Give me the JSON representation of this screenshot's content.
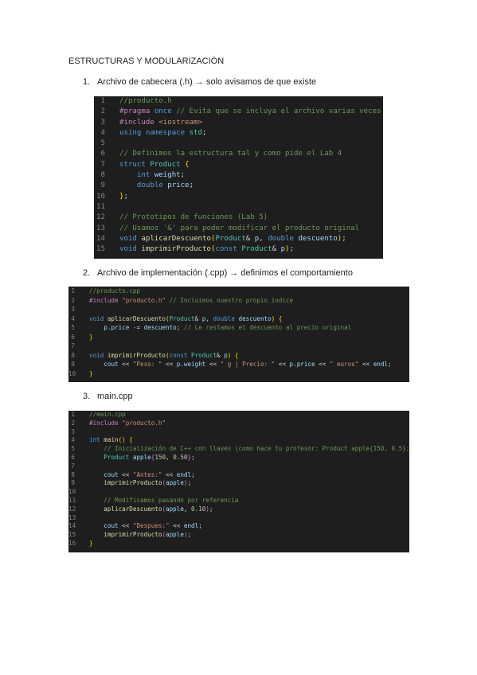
{
  "heading": "ESTRUCTURAS Y MODULARIZACIÓN",
  "items": [
    {
      "number": "1.",
      "label": "Archivo de cabecera (.h) → solo avisamos de que existe"
    },
    {
      "number": "2.",
      "label": "Archivo de implementación (.cpp) → definimos el comportamiento"
    },
    {
      "number": "3.",
      "label": "main.cpp"
    }
  ],
  "code_blocks": [
    {
      "file": "producto.h",
      "lines": [
        {
          "n": "1",
          "tokens": [
            [
              "c",
              "//producto.h"
            ]
          ]
        },
        {
          "n": "2",
          "tokens": [
            [
              "pp",
              "#pragma "
            ],
            [
              "kw",
              "once"
            ],
            [
              "c",
              " // Evita que se incluya el archivo varias veces"
            ]
          ]
        },
        {
          "n": "3",
          "tokens": [
            [
              "pp",
              "#include "
            ],
            [
              "st",
              "<iostream>"
            ]
          ]
        },
        {
          "n": "4",
          "tokens": [
            [
              "kw",
              "using "
            ],
            [
              "kw",
              "namespace "
            ],
            [
              "ty",
              "std"
            ],
            [
              "pu",
              ";"
            ]
          ]
        },
        {
          "n": "5",
          "tokens": []
        },
        {
          "n": "6",
          "tokens": [
            [
              "c",
              "// Definimos la estructura tal y como pide el Lab 4"
            ]
          ]
        },
        {
          "n": "7",
          "tokens": [
            [
              "kw",
              "struct "
            ],
            [
              "ty",
              "Product "
            ],
            [
              "br",
              "{"
            ]
          ]
        },
        {
          "n": "8",
          "tokens": [
            [
              "pu",
              "    "
            ],
            [
              "kw",
              "int "
            ],
            [
              "id",
              "weight"
            ],
            [
              "pu",
              ";"
            ]
          ]
        },
        {
          "n": "9",
          "tokens": [
            [
              "pu",
              "    "
            ],
            [
              "kw",
              "double "
            ],
            [
              "id",
              "price"
            ],
            [
              "pu",
              ";"
            ]
          ]
        },
        {
          "n": "10",
          "tokens": [
            [
              "br",
              "}"
            ],
            [
              "pu",
              ";"
            ]
          ]
        },
        {
          "n": "11",
          "tokens": []
        },
        {
          "n": "12",
          "tokens": [
            [
              "c",
              "// Prototipos de funciones (Lab 5)"
            ]
          ]
        },
        {
          "n": "13",
          "tokens": [
            [
              "c",
              "// Usamos '&' para poder modificar el producto original"
            ]
          ]
        },
        {
          "n": "14",
          "tokens": [
            [
              "kw",
              "void "
            ],
            [
              "fn",
              "aplicarDescuento"
            ],
            [
              "br",
              "("
            ],
            [
              "ty",
              "Product"
            ],
            [
              "pu",
              "& "
            ],
            [
              "id",
              "p"
            ],
            [
              "pu",
              ", "
            ],
            [
              "kw",
              "double "
            ],
            [
              "id",
              "descuento"
            ],
            [
              "br",
              ")"
            ],
            [
              "pu",
              ";"
            ]
          ]
        },
        {
          "n": "15",
          "tokens": [
            [
              "kw",
              "void "
            ],
            [
              "fn",
              "imprimirProducto"
            ],
            [
              "br",
              "("
            ],
            [
              "kw",
              "const "
            ],
            [
              "ty",
              "Product"
            ],
            [
              "pu",
              "& "
            ],
            [
              "id",
              "p"
            ],
            [
              "br",
              ")"
            ],
            [
              "pu",
              ";"
            ]
          ]
        }
      ]
    },
    {
      "file": "producto.cpp",
      "lines": [
        {
          "n": "1",
          "tokens": [
            [
              "c",
              "//producto.cpp"
            ]
          ]
        },
        {
          "n": "2",
          "tokens": [
            [
              "pp",
              "#include "
            ],
            [
              "st",
              "\"producto.h\""
            ],
            [
              "c",
              " // Incluimos nuestro propio índice"
            ]
          ]
        },
        {
          "n": "3",
          "tokens": []
        },
        {
          "n": "4",
          "tokens": [
            [
              "kw",
              "void "
            ],
            [
              "fn",
              "aplicarDescuento"
            ],
            [
              "br",
              "("
            ],
            [
              "ty",
              "Product"
            ],
            [
              "pu",
              "& "
            ],
            [
              "id",
              "p"
            ],
            [
              "pu",
              ", "
            ],
            [
              "kw",
              "double "
            ],
            [
              "id",
              "descuento"
            ],
            [
              "br",
              ") {"
            ]
          ]
        },
        {
          "n": "5",
          "tokens": [
            [
              "pu",
              "    "
            ],
            [
              "id",
              "p"
            ],
            [
              "pu",
              "."
            ],
            [
              "id",
              "price"
            ],
            [
              "pu",
              " -= "
            ],
            [
              "id",
              "descuento"
            ],
            [
              "pu",
              "; "
            ],
            [
              "c",
              "// Le restamos el descuento al precio original"
            ]
          ]
        },
        {
          "n": "6",
          "tokens": [
            [
              "br",
              "}"
            ]
          ]
        },
        {
          "n": "7",
          "tokens": []
        },
        {
          "n": "8",
          "tokens": [
            [
              "kw",
              "void "
            ],
            [
              "fn",
              "imprimirProducto"
            ],
            [
              "br",
              "("
            ],
            [
              "kw",
              "const "
            ],
            [
              "ty",
              "Product"
            ],
            [
              "pu",
              "& "
            ],
            [
              "id",
              "p"
            ],
            [
              "br",
              ") {"
            ]
          ]
        },
        {
          "n": "9",
          "tokens": [
            [
              "pu",
              "    "
            ],
            [
              "id",
              "cout"
            ],
            [
              "pu",
              " << "
            ],
            [
              "st",
              "\"Peso: \""
            ],
            [
              "pu",
              " << "
            ],
            [
              "id",
              "p"
            ],
            [
              "pu",
              "."
            ],
            [
              "id",
              "weight"
            ],
            [
              "pu",
              " << "
            ],
            [
              "st",
              "\" g | Precio: \""
            ],
            [
              "pu",
              " << "
            ],
            [
              "id",
              "p"
            ],
            [
              "pu",
              "."
            ],
            [
              "id",
              "price"
            ],
            [
              "pu",
              " << "
            ],
            [
              "st",
              "\" euros\""
            ],
            [
              "pu",
              " << "
            ],
            [
              "id",
              "endl"
            ],
            [
              "pu",
              ";"
            ]
          ]
        },
        {
          "n": "10",
          "tokens": [
            [
              "br",
              "}"
            ]
          ]
        }
      ]
    },
    {
      "file": "main.cpp",
      "lines": [
        {
          "n": "1",
          "tokens": [
            [
              "c",
              "//main.cpp"
            ]
          ]
        },
        {
          "n": "2",
          "tokens": [
            [
              "pp",
              "#include "
            ],
            [
              "st",
              "\"producto.h\""
            ]
          ]
        },
        {
          "n": "3",
          "tokens": []
        },
        {
          "n": "4",
          "tokens": [
            [
              "kw",
              "int "
            ],
            [
              "fn",
              "main"
            ],
            [
              "br",
              "() {"
            ]
          ]
        },
        {
          "n": "5",
          "tokens": [
            [
              "pu",
              "    "
            ],
            [
              "c",
              "// Inicialización de C++ con llaves (como hace tu profesor: Product apple{150, 0.5};)"
            ]
          ]
        },
        {
          "n": "6",
          "tokens": [
            [
              "pu",
              "    "
            ],
            [
              "ty",
              "Product "
            ],
            [
              "id",
              "apple"
            ],
            [
              "bp",
              "{"
            ],
            [
              "nm",
              "150"
            ],
            [
              "pu",
              ", "
            ],
            [
              "nm",
              "0.50"
            ],
            [
              "bp",
              "}"
            ],
            [
              "pu",
              ";"
            ]
          ]
        },
        {
          "n": "7",
          "tokens": []
        },
        {
          "n": "8",
          "tokens": [
            [
              "pu",
              "    "
            ],
            [
              "id",
              "cout"
            ],
            [
              "pu",
              " << "
            ],
            [
              "st",
              "\"Antes:\""
            ],
            [
              "pu",
              " << "
            ],
            [
              "id",
              "endl"
            ],
            [
              "pu",
              ";"
            ]
          ]
        },
        {
          "n": "9",
          "tokens": [
            [
              "pu",
              "    "
            ],
            [
              "fn",
              "imprimirProducto"
            ],
            [
              "bp",
              "("
            ],
            [
              "id",
              "apple"
            ],
            [
              "bp",
              ")"
            ],
            [
              "pu",
              ";"
            ]
          ]
        },
        {
          "n": "10",
          "tokens": []
        },
        {
          "n": "11",
          "tokens": [
            [
              "pu",
              "    "
            ],
            [
              "c",
              "// Modificamos pasando por referencia"
            ]
          ]
        },
        {
          "n": "12",
          "tokens": [
            [
              "pu",
              "    "
            ],
            [
              "fn",
              "aplicarDescuento"
            ],
            [
              "bp",
              "("
            ],
            [
              "id",
              "apple"
            ],
            [
              "pu",
              ", "
            ],
            [
              "nm",
              "0.10"
            ],
            [
              "bp",
              ")"
            ],
            [
              "pu",
              ";"
            ]
          ]
        },
        {
          "n": "13",
          "tokens": []
        },
        {
          "n": "14",
          "tokens": [
            [
              "pu",
              "    "
            ],
            [
              "id",
              "cout"
            ],
            [
              "pu",
              " << "
            ],
            [
              "st",
              "\"Despues:\""
            ],
            [
              "pu",
              " << "
            ],
            [
              "id",
              "endl"
            ],
            [
              "pu",
              ";"
            ]
          ]
        },
        {
          "n": "15",
          "tokens": [
            [
              "pu",
              "    "
            ],
            [
              "fn",
              "imprimirProducto"
            ],
            [
              "bp",
              "("
            ],
            [
              "id",
              "apple"
            ],
            [
              "bp",
              ")"
            ],
            [
              "pu",
              ";"
            ]
          ]
        },
        {
          "n": "16",
          "tokens": [
            [
              "br",
              "}"
            ]
          ]
        }
      ]
    }
  ]
}
